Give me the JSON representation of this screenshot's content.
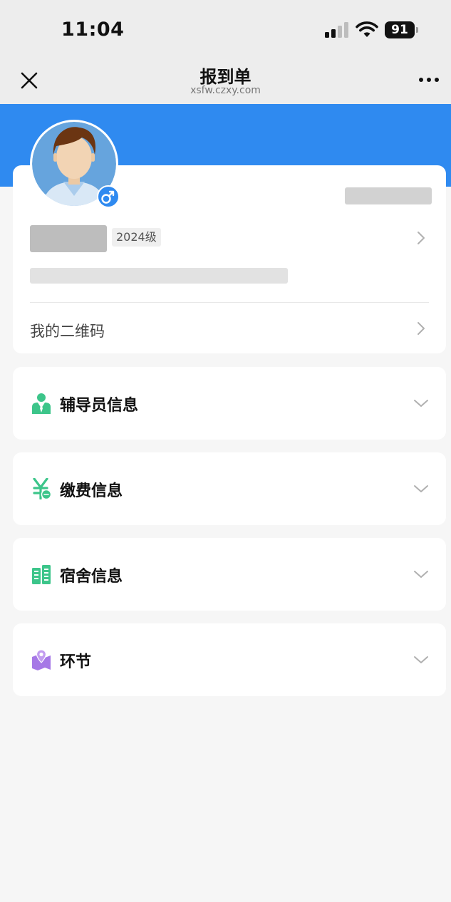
{
  "status_bar": {
    "time": "11:04",
    "battery": "91"
  },
  "nav": {
    "title": "报到单",
    "domain": "xsfw.czxy.com"
  },
  "profile": {
    "grade": "2024级",
    "qr_code_label": "我的二维码"
  },
  "sections": [
    {
      "label": "辅导员信息",
      "icon": "counselor-icon"
    },
    {
      "label": "缴费信息",
      "icon": "payment-icon"
    },
    {
      "label": "宿舍信息",
      "icon": "dormitory-icon"
    },
    {
      "label": "环节",
      "icon": "steps-icon"
    }
  ],
  "colors": {
    "brand_blue": "#2f8af0",
    "icon_green": "#3cc58a",
    "icon_purple": "#a678e6"
  }
}
